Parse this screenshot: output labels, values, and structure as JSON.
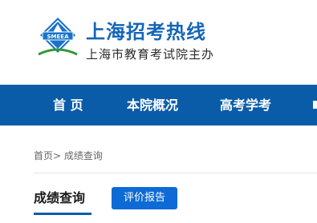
{
  "header": {
    "title": "上海招考热线",
    "subtitle": "上海市教育考试院主办",
    "logo_text": "SMEEA"
  },
  "nav": {
    "items": [
      {
        "label": "首 页"
      },
      {
        "label": "本院概况"
      },
      {
        "label": "高考学考"
      }
    ]
  },
  "breadcrumb": {
    "home": "首页>",
    "current": "成绩查询"
  },
  "section": {
    "title": "成绩查询",
    "button_label": "评价报告"
  },
  "colors": {
    "brand_blue": "#1566b8",
    "nav_bg": "#0b5ca8",
    "button_bg": "#0e6ad4"
  }
}
